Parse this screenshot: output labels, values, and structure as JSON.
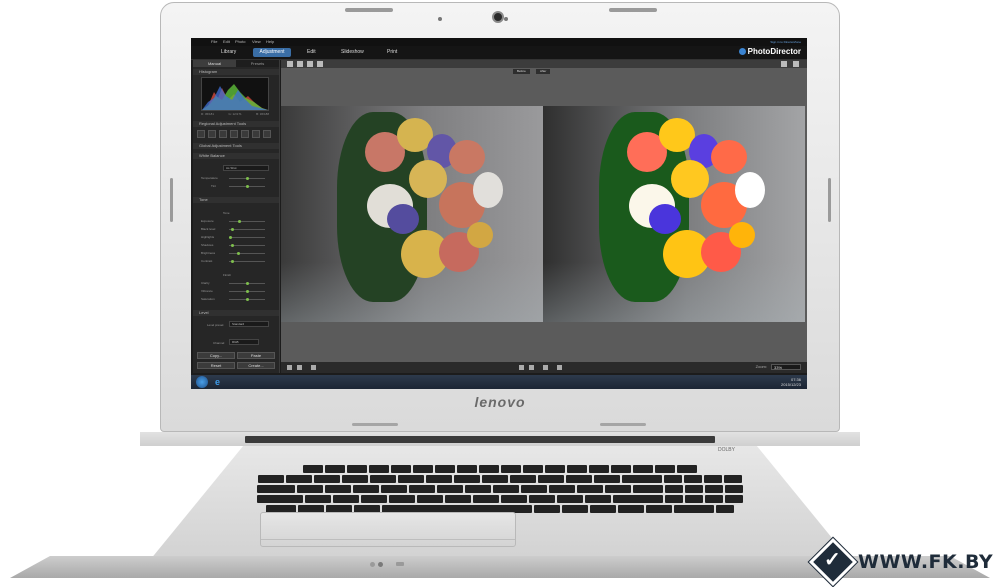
{
  "app": {
    "title": "PhotoDirector",
    "sign_in": "Sign in to DirectorZone",
    "menu": [
      "File",
      "Edit",
      "Photo",
      "View",
      "Help"
    ],
    "nav_tabs": [
      {
        "label": "Library",
        "active": false
      },
      {
        "label": "Adjustment",
        "active": true
      },
      {
        "label": "Edit",
        "active": false
      },
      {
        "label": "Slideshow",
        "active": false
      },
      {
        "label": "Print",
        "active": false
      }
    ],
    "accent_color": "#3a6ea6"
  },
  "left_panel": {
    "tabs": [
      "Manual",
      "Presets"
    ],
    "histogram": {
      "title": "Histogram",
      "values": [
        "R: 45/181",
        "G: 12/171",
        "B: 36/188"
      ]
    },
    "regional_tools": "Regional Adjustment Tools",
    "global_tools": "Global Adjustment Tools",
    "white_balance": {
      "title": "White Balance",
      "preset": "As Shot",
      "sliders": [
        "Temperature",
        "Tint"
      ]
    },
    "tone": {
      "title": "Tone",
      "tone_label": "Tone",
      "tone_sliders": [
        "Exposure",
        "Black level",
        "Highlights",
        "Shadows",
        "Brightness",
        "Contrast"
      ],
      "finish_label": "Finish",
      "finish_sliders": [
        "Clarity",
        "Vibrance",
        "Saturation"
      ]
    },
    "level": {
      "title": "Level",
      "preset_label": "Level preset:",
      "preset": "Standard",
      "channel_label": "Channel:",
      "channel": "RGB"
    },
    "buttons": {
      "copy": "Copy...",
      "paste": "Paste",
      "reset": "Reset",
      "create": "Create..."
    }
  },
  "main": {
    "before_label": "Before",
    "after_label": "After",
    "zoom_label": "Zoom:",
    "zoom_value": "33%"
  },
  "taskbar": {
    "time": "07:36",
    "date": "2015/12/23"
  },
  "laptop": {
    "brand": "lenovo",
    "dolby": "DOLBY"
  },
  "watermark": {
    "text": "WWW.FK.BY",
    "check": "✓"
  }
}
